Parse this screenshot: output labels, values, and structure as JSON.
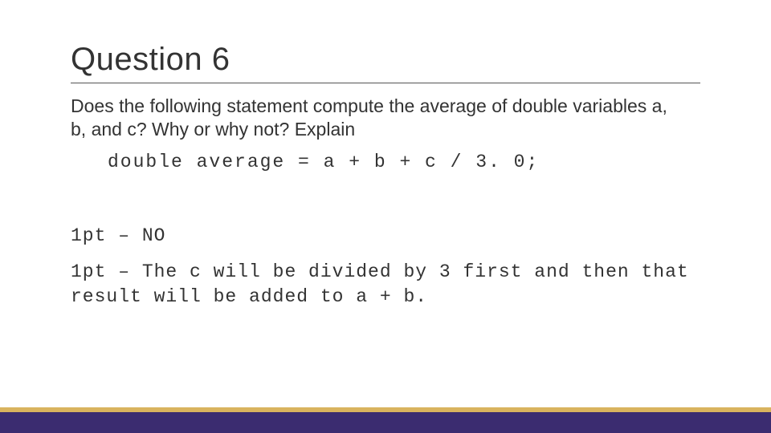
{
  "slide": {
    "title": "Question 6",
    "prompt": "Does the following statement compute the average of double variables a, b, and c? Why or why not?  Explain",
    "code": "double average = a + b + c / 3. 0;",
    "answers": [
      "1pt – NO",
      "1pt – The c will be divided by 3 first and then that result will be added to a + b."
    ]
  }
}
